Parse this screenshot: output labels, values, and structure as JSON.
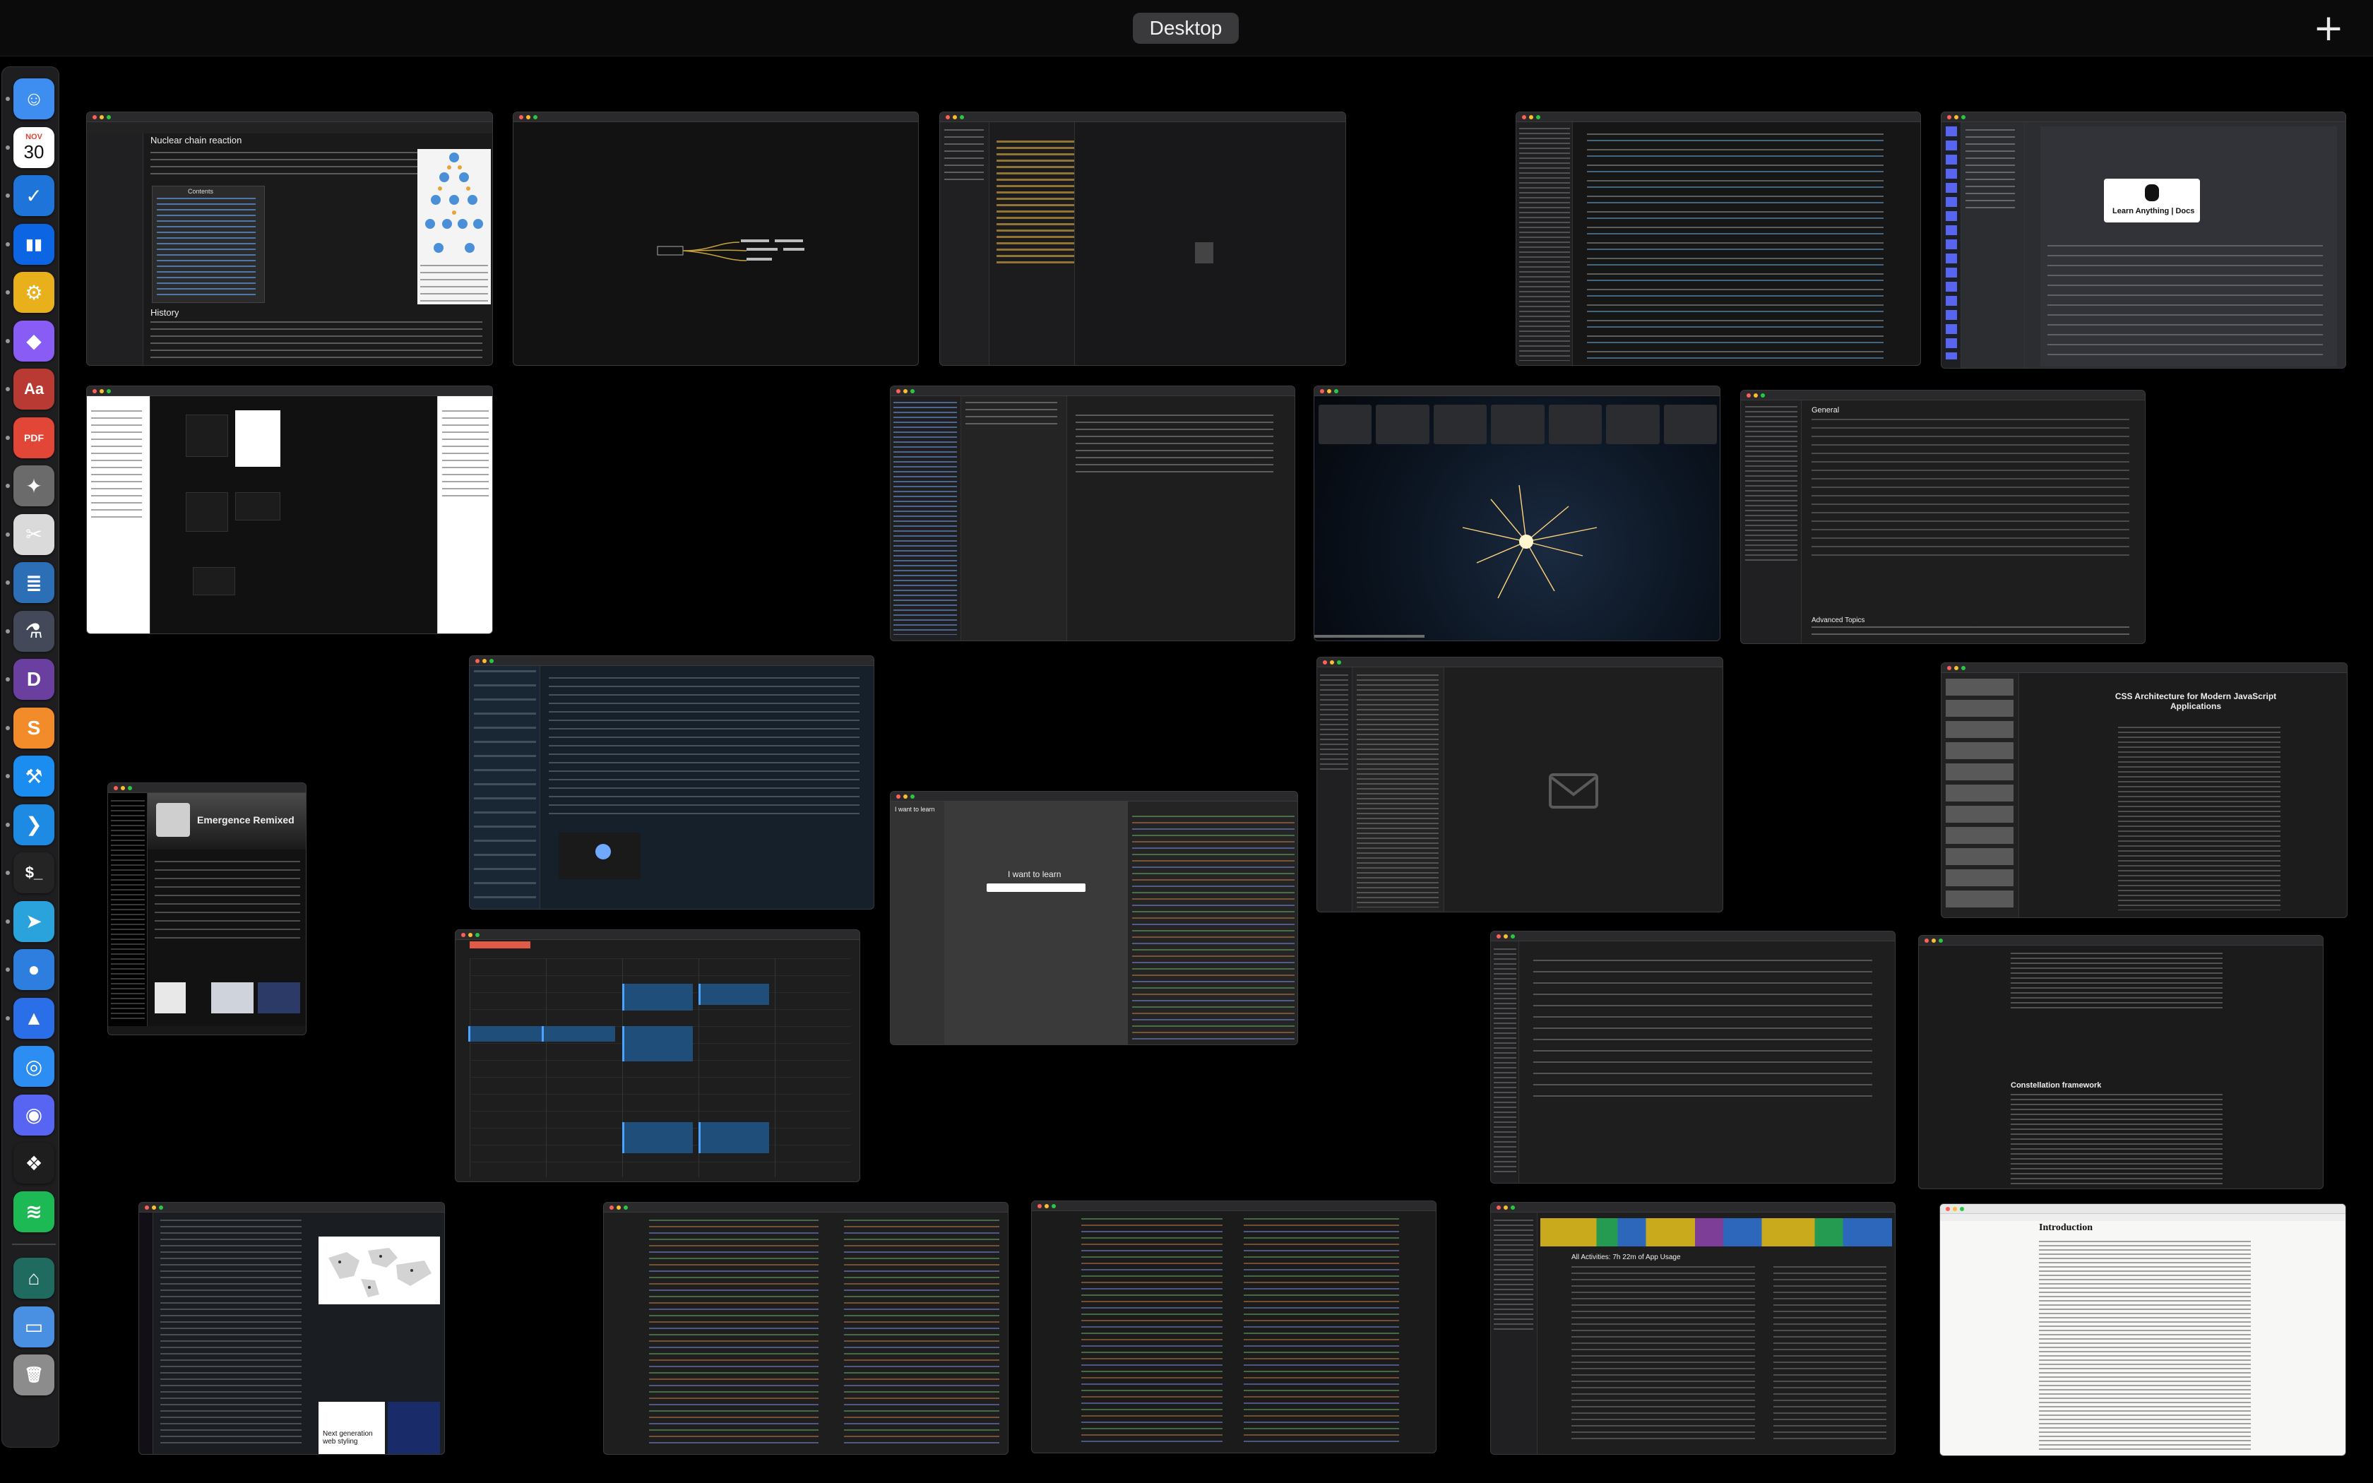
{
  "mission_control": {
    "space_label": "Desktop",
    "add_space_symbol": "+"
  },
  "dock": {
    "calendar_month": "NOV",
    "calendar_day": "30",
    "apps": [
      {
        "name": "finder-icon",
        "color": "#3d8ef0",
        "glyph": "☺"
      },
      {
        "name": "calendar-icon",
        "color": "#ffffff",
        "glyph": ""
      },
      {
        "name": "things-icon",
        "color": "#1e74d8",
        "glyph": "✓"
      },
      {
        "name": "trello-icon",
        "color": "#0c66e4",
        "glyph": "▮▮"
      },
      {
        "name": "instruments-icon",
        "color": "#e8b01a",
        "glyph": "⚙"
      },
      {
        "name": "affinity-icon",
        "color": "#8a5cf6",
        "glyph": "◆"
      },
      {
        "name": "dictionary-icon",
        "color": "#b83a32",
        "glyph": "Aa"
      },
      {
        "name": "pdf-expert-icon",
        "color": "#e24636",
        "glyph": "PDF"
      },
      {
        "name": "settings-star-icon",
        "color": "#6b6b6b",
        "glyph": "✦"
      },
      {
        "name": "scissors-tool-icon",
        "color": "#dadada",
        "glyph": "✂"
      },
      {
        "name": "stack-app-icon",
        "color": "#2d6fb7",
        "glyph": "≣"
      },
      {
        "name": "flask-app-icon",
        "color": "#44495a",
        "glyph": "⚗"
      },
      {
        "name": "dash-app-icon",
        "color": "#6b3fa0",
        "glyph": "D"
      },
      {
        "name": "sublime-text-icon",
        "color": "#f28b2a",
        "glyph": "S"
      },
      {
        "name": "xcode-icon",
        "color": "#1b8cf0",
        "glyph": "⚒"
      },
      {
        "name": "vscode-icon",
        "color": "#1d8be3",
        "glyph": "❯"
      },
      {
        "name": "terminal-icon",
        "color": "#242424",
        "glyph": "$_"
      },
      {
        "name": "telegram-icon",
        "color": "#2aa3dc",
        "glyph": "➤"
      },
      {
        "name": "tweetbot-icon",
        "color": "#2e7ee0",
        "glyph": "●"
      },
      {
        "name": "navigation-app-icon",
        "color": "#2a6ee8",
        "glyph": "▲"
      },
      {
        "name": "safari-icon",
        "color": "#2c8ef3",
        "glyph": "◎"
      },
      {
        "name": "discord-icon",
        "color": "#5865f2",
        "glyph": "◉"
      },
      {
        "name": "figma-icon",
        "color": "#1e1e1e",
        "glyph": "❖"
      },
      {
        "name": "spotify-icon",
        "color": "#1db954",
        "glyph": "≋"
      },
      {
        "name": "database-app-icon",
        "color": "#1f6b60",
        "glyph": "⌂"
      },
      {
        "name": "downloads-folder-icon",
        "color": "#4a90e2",
        "glyph": "▭"
      },
      {
        "name": "trash-icon",
        "color": "#8c8c8c",
        "glyph": "🗑"
      }
    ]
  },
  "windows": {
    "wiki": {
      "title": "Nuclear chain reaction",
      "section": "History",
      "contents": "Contents"
    },
    "spotify": {
      "album": "Emergence Remixed",
      "tile_name": "Next generation web styling"
    },
    "twitter": {
      "image_caption": "Next generation web styling"
    },
    "docs": {
      "heading": "Learn Anything | Docs"
    },
    "learn": {
      "heading": "I want to learn",
      "sidebar_heading": "I want to learn"
    },
    "article": {
      "title": "CSS Architecture for Modern JavaScript Applications"
    },
    "paper": {
      "title": "Introduction"
    },
    "constellation": {
      "heading": "Constellation framework"
    },
    "settings": {
      "heading": "General",
      "section": "Advanced Topics"
    },
    "activity": {
      "title": "All Activities: 7h 22m of App Usage"
    }
  }
}
